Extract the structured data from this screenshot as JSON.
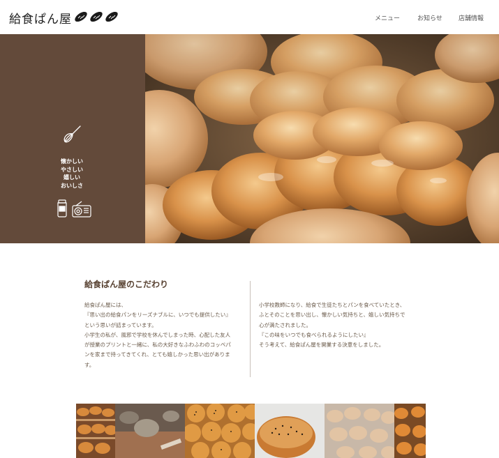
{
  "header": {
    "logo": "給食ぱん屋",
    "nav": [
      {
        "label": "メニュー"
      },
      {
        "label": "お知らせ"
      },
      {
        "label": "店舗情報"
      }
    ]
  },
  "hero": {
    "tagline": [
      "懐かしい",
      "やさしい",
      "嬉しい",
      "おいしさ"
    ],
    "colors": {
      "side": "#634a3a"
    },
    "icons": [
      "whisk-icon",
      "milk-jar-icon",
      "radio-icon"
    ]
  },
  "about": {
    "title": "給食ぱん屋のこだわり",
    "left_lines": [
      "給食ぱん屋には、",
      "『思い出の給食パンをリーズナブルに、いつでも提供したい』",
      "という思いが詰まっています。",
      "小学生の私が、風邪で学校を休んでしまった時、心配した友人",
      "が授業のプリントと一緒に、私の大好きなふわふわのコッペパ",
      "ンを家まで持ってきてくれ、とても嬉しかった思い出がありま",
      "す。"
    ],
    "right_lines": [
      "小学校教師になり、給食で生徒たちとパンを食べていたとき、",
      "ふとそのことを思い出し、懐かしい気持ちと、嬉しい気持ちで",
      "心が満たされました。",
      "『この味をいつでも食べられるようにしたい』",
      "そう考えて、給食ぱん屋を開業する決意をしました。"
    ]
  }
}
